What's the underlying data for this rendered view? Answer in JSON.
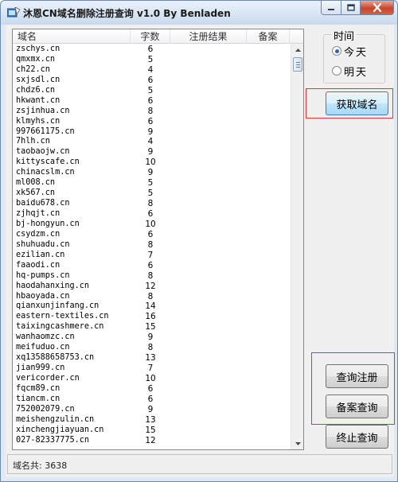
{
  "window": {
    "title": "沐恩CN域名删除注册查询 v1.0 By Benladen"
  },
  "listview": {
    "columns": [
      "域名",
      "字数",
      "注册结果",
      "备案"
    ],
    "rows": [
      {
        "domain": "zschys.cn",
        "len": "6"
      },
      {
        "domain": "qmxmx.cn",
        "len": "5"
      },
      {
        "domain": "ch22.cn",
        "len": "4"
      },
      {
        "domain": "sxjsdl.cn",
        "len": "6"
      },
      {
        "domain": "chdz6.cn",
        "len": "5"
      },
      {
        "domain": "hkwant.cn",
        "len": "6"
      },
      {
        "domain": "zsjinhua.cn",
        "len": "8"
      },
      {
        "domain": "klmyhs.cn",
        "len": "6"
      },
      {
        "domain": "997661175.cn",
        "len": "9"
      },
      {
        "domain": "7hlh.cn",
        "len": "4"
      },
      {
        "domain": "taobaojw.cn",
        "len": "9"
      },
      {
        "domain": "kittyscafe.cn",
        "len": "10"
      },
      {
        "domain": "chinacslm.cn",
        "len": "9"
      },
      {
        "domain": "ml008.cn",
        "len": "5"
      },
      {
        "domain": "xk567.cn",
        "len": "5"
      },
      {
        "domain": "baidu678.cn",
        "len": "8"
      },
      {
        "domain": "zjhqjt.cn",
        "len": "6"
      },
      {
        "domain": "bj-hongyun.cn",
        "len": "10"
      },
      {
        "domain": "csydzm.cn",
        "len": "6"
      },
      {
        "domain": "shuhuadu.cn",
        "len": "8"
      },
      {
        "domain": "ezilian.cn",
        "len": "7"
      },
      {
        "domain": "faaodi.cn",
        "len": "6"
      },
      {
        "domain": "hq-pumps.cn",
        "len": "8"
      },
      {
        "domain": "haodahanxing.cn",
        "len": "12"
      },
      {
        "domain": "hbaoyada.cn",
        "len": "8"
      },
      {
        "domain": "qianxunjinfang.cn",
        "len": "14"
      },
      {
        "domain": "eastern-textiles.cn",
        "len": "16"
      },
      {
        "domain": "taixingcashmere.cn",
        "len": "15"
      },
      {
        "domain": "wanhaomzc.cn",
        "len": "9"
      },
      {
        "domain": "meifuduo.cn",
        "len": "8"
      },
      {
        "domain": "xq13588658753.cn",
        "len": "13"
      },
      {
        "domain": "jian999.cn",
        "len": "7"
      },
      {
        "domain": "vericorder.cn",
        "len": "10"
      },
      {
        "domain": "fqcm89.cn",
        "len": "6"
      },
      {
        "domain": "tiancm.cn",
        "len": "6"
      },
      {
        "domain": "752002079.cn",
        "len": "9"
      },
      {
        "domain": "meishengzulin.cn",
        "len": "13"
      },
      {
        "domain": "xinchengjiayuan.cn",
        "len": "15"
      },
      {
        "domain": "027-82337775.cn",
        "len": "12"
      }
    ]
  },
  "time_group": {
    "title": "时间",
    "options": [
      "今天",
      "明天"
    ],
    "selected": "今天"
  },
  "buttons": {
    "fetch": "获取域名",
    "query_register": "查询注册",
    "query_record": "备案查询",
    "stop": "终止查询"
  },
  "status": {
    "text": "域名共: 3638"
  },
  "colors": {
    "highlight_box": "#e0363b",
    "radio_selected": "#2d62b8"
  }
}
